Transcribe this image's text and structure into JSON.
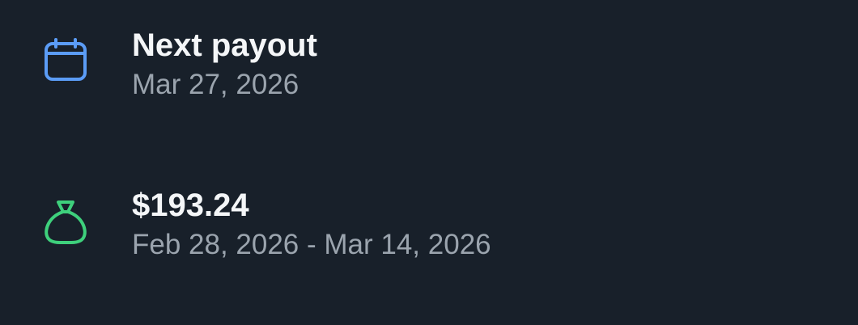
{
  "payout": {
    "icon": "calendar-icon",
    "icon_color": "#5b9cf6",
    "title": "Next payout",
    "date": "Mar 27, 2026"
  },
  "earnings": {
    "icon": "money-bag-icon",
    "icon_color": "#3ed07c",
    "amount": "$193.24",
    "period": "Feb 28, 2026 - Mar 14, 2026"
  },
  "colors": {
    "background": "#18202a",
    "primary_text": "#f4f6f8",
    "secondary_text": "#9ba4ae"
  }
}
